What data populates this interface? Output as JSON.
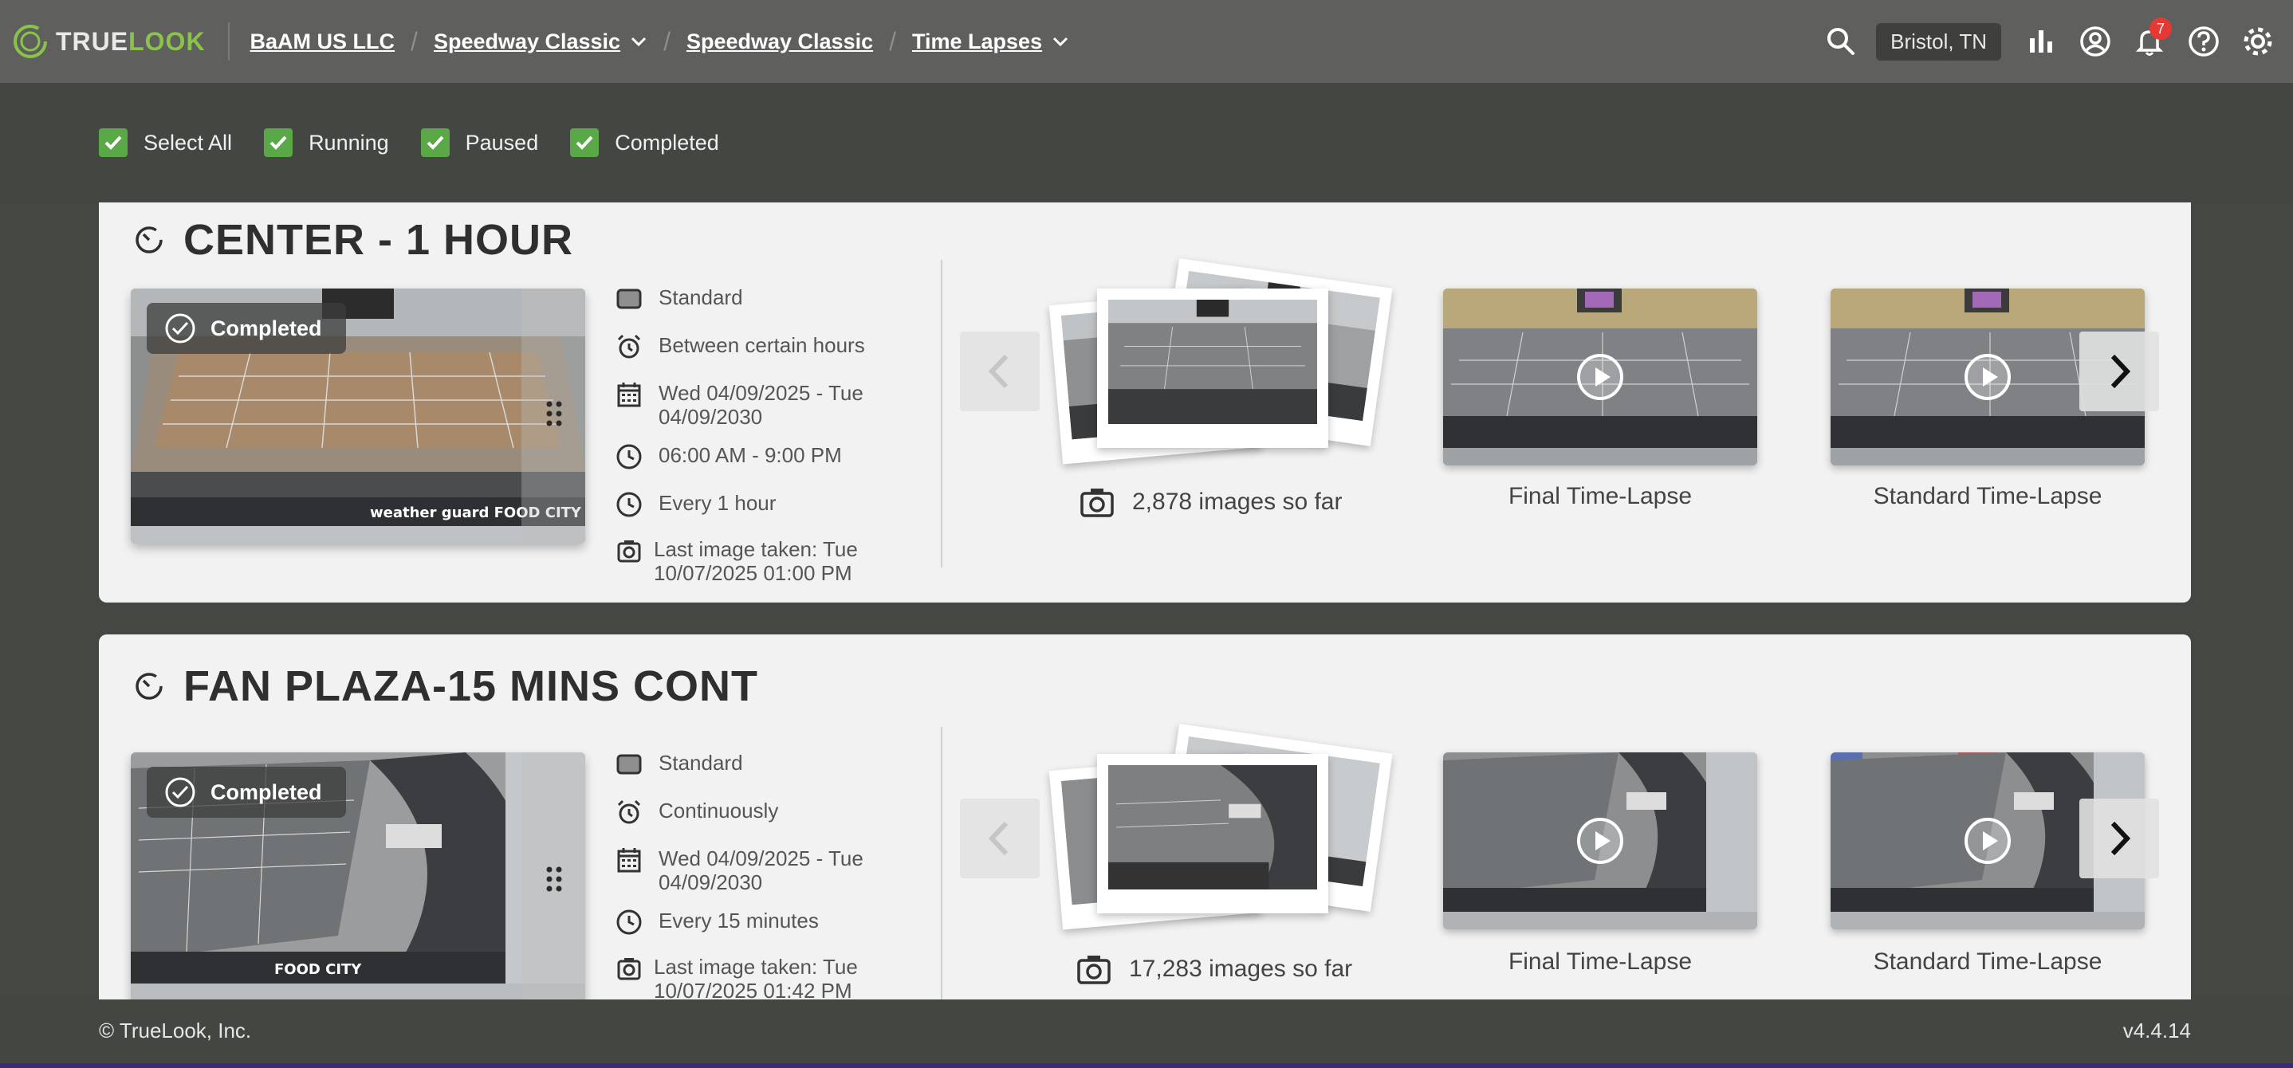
{
  "header": {
    "logo_part1": "TRUE",
    "logo_part2": "LOOK",
    "breadcrumbs": [
      "BaAM US LLC",
      "Speedway Classic",
      "Speedway Classic",
      "Time Lapses"
    ],
    "location": "Bristol, TN",
    "notification_count": "7",
    "colors": {
      "bg": "#5f605d",
      "accent": "#8bc34a"
    }
  },
  "filters": [
    {
      "label": "Select All",
      "checked": true
    },
    {
      "label": "Running",
      "checked": true
    },
    {
      "label": "Paused",
      "checked": true
    },
    {
      "label": "Completed",
      "checked": true
    }
  ],
  "cards": [
    {
      "title": "CENTER - 1 HOUR",
      "status": "Completed",
      "details": {
        "type": "Standard",
        "schedule": "Between certain hours",
        "date_range": "Wed 04/09/2025 - Tue 04/09/2030",
        "hours": "06:00 AM - 9:00 PM",
        "interval": "Every 1 hour",
        "last_image": "Last image taken: Tue 10/07/2025 01:00 PM"
      },
      "image_count": "2,878 images so far",
      "videos": [
        "Final Time-Lapse",
        "Standard Time-Lapse"
      ]
    },
    {
      "title": "FAN PLAZA-15 MINS CONT",
      "status": "Completed",
      "details": {
        "type": "Standard",
        "schedule": "Continuously",
        "date_range": "Wed 04/09/2025 - Tue 04/09/2030",
        "interval": "Every 15 minutes",
        "last_image": "Last image taken: Tue 10/07/2025 01:42 PM"
      },
      "image_count": "17,283 images so far",
      "videos": [
        "Final Time-Lapse",
        "Standard Time-Lapse"
      ]
    }
  ],
  "footer": {
    "copyright": "© TrueLook, Inc.",
    "version": "v4.4.14"
  }
}
